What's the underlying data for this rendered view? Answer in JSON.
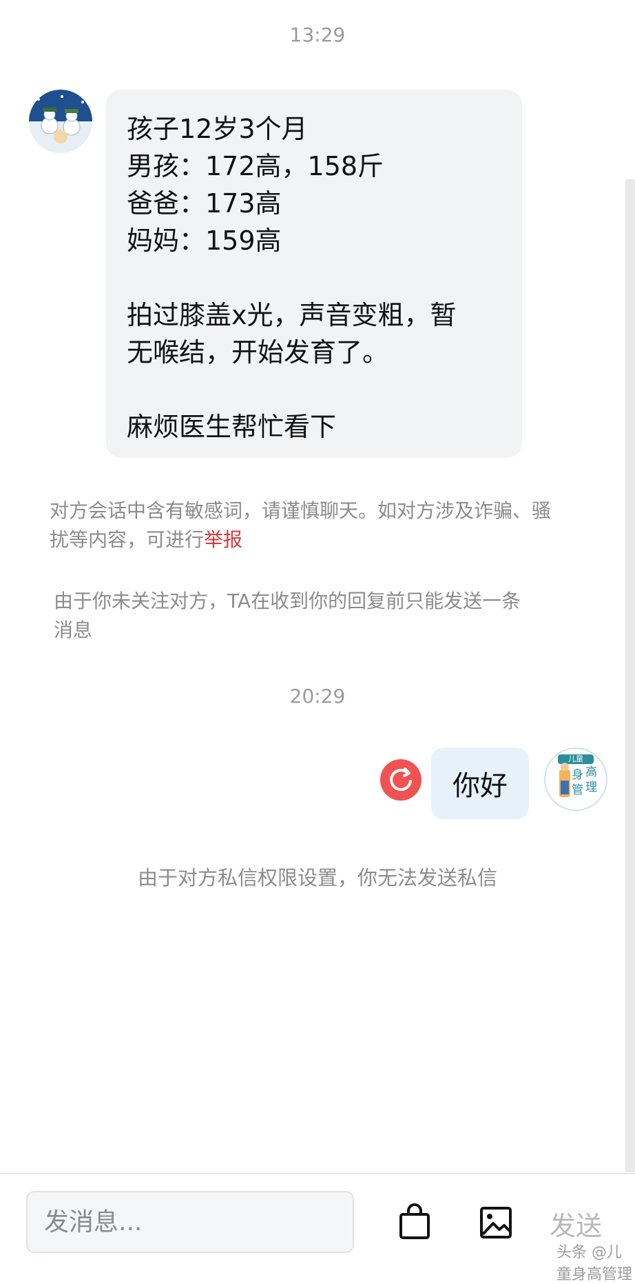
{
  "chat": {
    "timestamp_1": "13:29",
    "incoming_message": {
      "lines": [
        "孩子12岁3个月",
        "男孩：172高，158斤",
        "爸爸：173高",
        "妈妈：159高",
        "",
        "拍过膝盖x光，声音变粗，暂",
        "无喉结，开始发育了。",
        "",
        "麻烦医生帮忙看下"
      ]
    },
    "sensitive_notice": {
      "line1": "对方会话中含有敏感词，请谨慎聊天。如对方涉及诈骗、骚",
      "line2_prefix": "扰等内容，可进行",
      "report_link": "举报"
    },
    "follow_notice": {
      "line1": "由于你未关注对方，TA在收到你的回复前只能发送一条",
      "line2": "消息"
    },
    "timestamp_2": "20:29",
    "outgoing_message": "你好",
    "outgoing_avatar_text": {
      "top": "儿童",
      "left_top": "身",
      "right_top": "高",
      "left_bottom": "管",
      "right_bottom": "理"
    },
    "permission_notice": "由于对方私信权限设置，你无法发送私信"
  },
  "input_bar": {
    "placeholder": "发消息...",
    "send_label": "发送"
  },
  "watermark": "头条 @儿童身高管理",
  "colors": {
    "incoming_bubble": "#f2f3f5",
    "outgoing_bubble": "#e7f1fc",
    "report_link": "#d23a3a",
    "resend_icon": "#f05252",
    "muted_text": "#8c8c8c"
  }
}
